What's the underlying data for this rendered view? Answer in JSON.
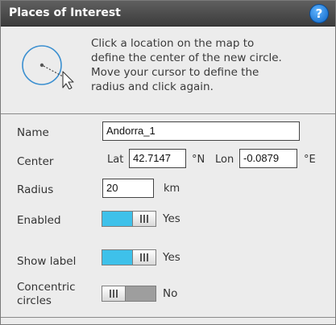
{
  "panel": {
    "title": "Places of Interest",
    "help_label": "?",
    "instructions": "Click a location on the map to\ndefine the center of the new circle.\nMove your cursor to define the\nradius and click again."
  },
  "form": {
    "name": {
      "label": "Name",
      "value": "Andorra_1"
    },
    "center": {
      "label": "Center",
      "lat_label": "Lat",
      "lat_value": "42.7147",
      "lat_unit": "°N",
      "lon_label": "Lon",
      "lon_value": "-0.0879",
      "lon_unit": "°E"
    },
    "radius": {
      "label": "Radius",
      "value": "20",
      "unit": "km"
    },
    "enabled": {
      "label": "Enabled",
      "state_text": "Yes",
      "on": true
    },
    "show_label": {
      "label": "Show label",
      "state_text": "Yes",
      "on": true
    },
    "concentric": {
      "label": "Concentric\ncircles",
      "state_text": "No",
      "on": false
    }
  },
  "colors": {
    "titlebar": "#4a4a4a",
    "toggle_on": "#3ec1ea",
    "toggle_off": "#9e9e9e",
    "help_icon": "#1a7ee6"
  }
}
